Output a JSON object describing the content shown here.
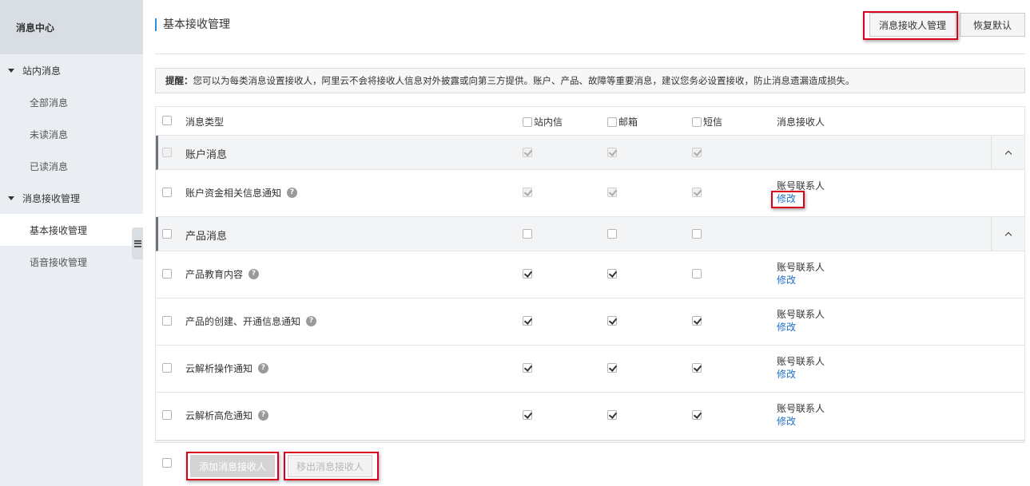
{
  "sidebar": {
    "header": "消息中心",
    "groups": [
      {
        "label": "站内消息",
        "items": [
          "全部消息",
          "未读消息",
          "已读消息"
        ]
      },
      {
        "label": "消息接收管理",
        "items": [
          "基本接收管理",
          "语音接收管理"
        ]
      }
    ]
  },
  "header": {
    "title": "基本接收管理",
    "receivers_button": "消息接收人管理",
    "restore_button": "恢复默认"
  },
  "tip": {
    "bold": "提醒：",
    "text": "您可以为每类消息设置接收人，阿里云不会将接收人信息对外披露或向第三方提供。账户、产品、故障等重要消息，建议您务必设置接收，防止消息遗漏造成损失。"
  },
  "table": {
    "columns": [
      "消息类型",
      "站内信",
      "邮箱",
      "短信",
      "消息接收人"
    ],
    "groups": [
      {
        "name": "账户消息",
        "inbox": true,
        "email": true,
        "sms": true,
        "disabled": true,
        "rows": [
          {
            "name": "账户资金相关信息通知",
            "inbox": true,
            "email": true,
            "sms": true,
            "disabled": true,
            "receiver": "账号联系人",
            "action": "修改"
          }
        ]
      },
      {
        "name": "产品消息",
        "inbox": false,
        "email": false,
        "sms": false,
        "disabled": false,
        "rows": [
          {
            "name": "产品教育内容",
            "inbox": true,
            "email": true,
            "sms": false,
            "receiver": "账号联系人",
            "action": "修改"
          },
          {
            "name": "产品的创建、开通信息通知",
            "inbox": true,
            "email": true,
            "sms": true,
            "receiver": "账号联系人",
            "action": "修改"
          },
          {
            "name": "云解析操作通知",
            "inbox": true,
            "email": true,
            "sms": true,
            "receiver": "账号联系人",
            "action": "修改"
          },
          {
            "name": "云解析高危通知",
            "inbox": true,
            "email": true,
            "sms": true,
            "receiver": "账号联系人",
            "action": "修改"
          }
        ]
      }
    ]
  },
  "footer": {
    "add_button": "添加消息接收人",
    "remove_button": "移出消息接收人"
  },
  "colors": {
    "highlight": "#d9001b",
    "link": "#1f6fc5",
    "accent": "#2d8fd8"
  }
}
